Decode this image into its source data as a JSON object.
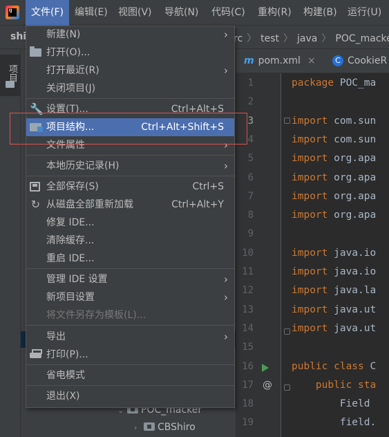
{
  "menubar": {
    "items": [
      "文件(F)",
      "编辑(E)",
      "视图(V)",
      "导航(N)",
      "代码(C)",
      "重构(R)",
      "构建(B)",
      "运行(U)"
    ],
    "active_index": 0
  },
  "navbar": {
    "project_fragment": "shi",
    "breadcrumbs": [
      "rc",
      "test",
      "java",
      "POC_macker"
    ]
  },
  "toolwindow": {
    "tab_label": "项目"
  },
  "project_tree": {
    "items": [
      "POC_macker",
      "CBShiro"
    ]
  },
  "editor": {
    "tabs": [
      {
        "icon": "m",
        "label": "pom.xml",
        "close": "×"
      },
      {
        "icon": "C",
        "label": "CookieR"
      }
    ],
    "lines": [
      {
        "n": "1",
        "kw": "package",
        "rest": " POC_ma"
      },
      {
        "n": "2",
        "kw": "",
        "rest": ""
      },
      {
        "n": "3",
        "kw": "import",
        "rest": " com.sun"
      },
      {
        "n": "4",
        "kw": "import",
        "rest": " com.sun"
      },
      {
        "n": "5",
        "kw": "import",
        "rest": " org.apa"
      },
      {
        "n": "6",
        "kw": "import",
        "rest": " org.apa"
      },
      {
        "n": "7",
        "kw": "import",
        "rest": " org.apa"
      },
      {
        "n": "8",
        "kw": "import",
        "rest": " org.apa"
      },
      {
        "n": "9",
        "kw": "",
        "rest": ""
      },
      {
        "n": "10",
        "kw": "import",
        "rest": " java.io"
      },
      {
        "n": "11",
        "kw": "import",
        "rest": " java.io"
      },
      {
        "n": "12",
        "kw": "import",
        "rest": " java.la"
      },
      {
        "n": "13",
        "kw": "import",
        "rest": " java.ut"
      },
      {
        "n": "14",
        "kw": "import",
        "rest": " java.ut"
      },
      {
        "n": "15",
        "kw": "",
        "rest": ""
      },
      {
        "n": "16",
        "kw": "public class",
        "rest": " C"
      },
      {
        "n": "17",
        "kw": "    public sta",
        "rest": ""
      },
      {
        "n": "18",
        "kw": "",
        "rest": "        Field"
      },
      {
        "n": "19",
        "kw": "",
        "rest": "        field."
      }
    ],
    "gutter_icons": {
      "run": "run-icon",
      "override": "@"
    }
  },
  "file_menu": {
    "items": [
      {
        "label": "新建(N)",
        "shortcut": "",
        "submenu": true,
        "icon": ""
      },
      {
        "label": "打开(O)...",
        "shortcut": "",
        "submenu": false,
        "icon": "folder-icon"
      },
      {
        "label": "打开最近(R)",
        "shortcut": "",
        "submenu": true,
        "icon": ""
      },
      {
        "label": "关闭项目(J)",
        "shortcut": "",
        "submenu": false,
        "icon": ""
      },
      {
        "label": "设置(T)...",
        "shortcut": "Ctrl+Alt+S",
        "submenu": false,
        "icon": "wrench-icon"
      },
      {
        "label": "项目结构...",
        "shortcut": "Ctrl+Alt+Shift+S",
        "submenu": false,
        "icon": "project-structure-icon",
        "selected": true
      },
      {
        "label": "文件属性",
        "shortcut": "",
        "submenu": true,
        "icon": ""
      },
      {
        "label": "本地历史记录(H)",
        "shortcut": "",
        "submenu": true,
        "icon": ""
      },
      {
        "label": "全部保存(S)",
        "shortcut": "Ctrl+S",
        "submenu": false,
        "icon": "save-icon"
      },
      {
        "label": "从磁盘全部重新加载",
        "shortcut": "Ctrl+Alt+Y",
        "submenu": false,
        "icon": "reload-icon"
      },
      {
        "label": "修复 IDE...",
        "shortcut": "",
        "submenu": false,
        "icon": ""
      },
      {
        "label": "清除缓存...",
        "shortcut": "",
        "submenu": false,
        "icon": ""
      },
      {
        "label": "重启 IDE...",
        "shortcut": "",
        "submenu": false,
        "icon": ""
      },
      {
        "label": "管理 IDE 设置",
        "shortcut": "",
        "submenu": true,
        "icon": ""
      },
      {
        "label": "新项目设置",
        "shortcut": "",
        "submenu": true,
        "icon": ""
      },
      {
        "label": "将文件另存为模板(L)...",
        "shortcut": "",
        "submenu": false,
        "icon": "",
        "disabled": true
      },
      {
        "label": "导出",
        "shortcut": "",
        "submenu": true,
        "icon": ""
      },
      {
        "label": "打印(P)...",
        "shortcut": "",
        "submenu": false,
        "icon": "print-icon"
      },
      {
        "label": "省电模式",
        "shortcut": "",
        "submenu": false,
        "icon": ""
      },
      {
        "label": "退出(X)",
        "shortcut": "",
        "submenu": false,
        "icon": ""
      }
    ]
  },
  "colors": {
    "menu_bg": "#3c3f41",
    "selection": "#4b6eaf",
    "editor_bg": "#2b2b2b",
    "keyword": "#cc7832",
    "highlight_box": "#d9534f"
  }
}
